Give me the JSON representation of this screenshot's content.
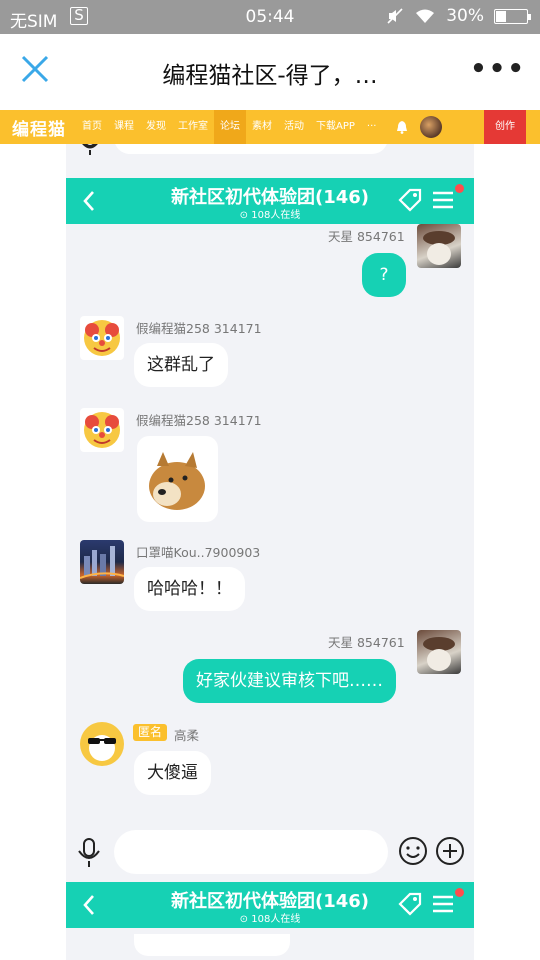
{
  "status_bar": {
    "carrier": "无SIM",
    "time": "05:44",
    "battery": "30%"
  },
  "browser": {
    "title": "编程猫社区-得了，…"
  },
  "site_nav": {
    "logo": "编程猫",
    "items": [
      "首页",
      "课程",
      "发现",
      "工作室",
      "论坛",
      "素材",
      "活动",
      "下载APP",
      "···"
    ],
    "active": "论坛",
    "create_label": "创作"
  },
  "chat": {
    "title": "新社区初代体验团(146)",
    "online": "108人在线",
    "messages": [
      {
        "side": "right",
        "name": "天星 854761",
        "text": "?"
      },
      {
        "side": "left",
        "name": "假编程猫258 314171",
        "text": "这群乱了"
      },
      {
        "side": "left",
        "name": "假编程猫258 314171",
        "image": "doge-sticker"
      },
      {
        "side": "left",
        "name": "口罩喵Kou..7900903",
        "text": "哈哈哈！！"
      },
      {
        "side": "right",
        "name": "天星 854761",
        "text": "好家伙建议审核下吧……"
      },
      {
        "side": "left",
        "badge": "匿名",
        "name": "高柔",
        "text": "大傻逼"
      }
    ],
    "input_placeholder": ""
  },
  "colors": {
    "teal": "#16d1b4",
    "nav_yellow": "#fbc02d",
    "create_red": "#e53935"
  }
}
